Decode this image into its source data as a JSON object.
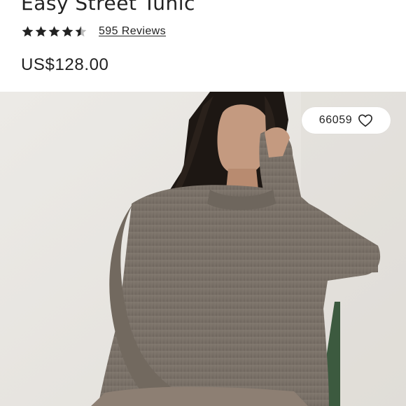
{
  "product": {
    "title": "Easy Street Tunic",
    "rating": 4.5,
    "rating_max": 5,
    "reviews_label": "595 Reviews",
    "price": "US$128.00"
  },
  "wishlist": {
    "count": "66059",
    "icon": "heart-icon"
  },
  "image": {
    "icon": "product-photo"
  },
  "colors": {
    "text": "#222222",
    "image_background": "#e9e7e3",
    "sweater": "#7f766c"
  }
}
